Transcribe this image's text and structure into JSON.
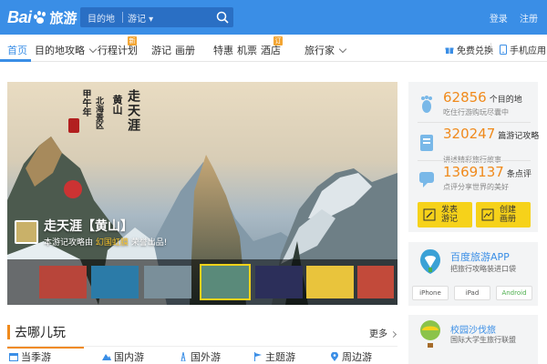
{
  "header": {
    "logo_text": "Bai",
    "logo_product": "旅游",
    "search_placeholder": "目的地",
    "search_kind": "游记",
    "top_links": [
      "登录",
      "注册"
    ]
  },
  "nav": {
    "items": [
      {
        "label": "首页",
        "active": true
      },
      {
        "label": "目的地攻略",
        "dropdown": true
      },
      {
        "label": "行程计划",
        "badge": "新"
      },
      {
        "label": "游记"
      },
      {
        "label": "画册"
      },
      {
        "label": "特惠"
      },
      {
        "label": "机票"
      },
      {
        "label": "酒店",
        "badge": "订"
      },
      {
        "label": "旅行家",
        "dropdown": true
      }
    ],
    "right": [
      {
        "label": "免费兑换",
        "icon": "gift-icon"
      },
      {
        "label": "手机应用",
        "icon": "phone-icon"
      }
    ]
  },
  "hero": {
    "calligraphy": [
      "走天涯",
      "黄山",
      "北海景区",
      "甲午年"
    ],
    "title": "走天涯【黄山】",
    "subtitle_prefix": "本游记攻略由",
    "subtitle_highlight": "幻国虹膜",
    "subtitle_suffix": "荣誉出品!",
    "thumbnails": 7,
    "active_thumbnail": 3
  },
  "stats": [
    {
      "number": "62856",
      "unit": "个目的地",
      "desc": "吃住行游购玩尽囊中",
      "icon": "footprint-icon"
    },
    {
      "number": "320247",
      "unit": "篇游记攻略",
      "desc": "讲述精彩旅行故事",
      "icon": "book-icon"
    },
    {
      "number": "1369137",
      "unit": "条点评",
      "desc": "点评分享世界的美好",
      "icon": "comment-icon"
    }
  ],
  "actions": [
    {
      "line1": "发表",
      "line2": "游记",
      "icon": "write-icon"
    },
    {
      "line1": "创建",
      "line2": "画册",
      "icon": "album-icon"
    }
  ],
  "app_promo": {
    "title": "百度旅游APP",
    "subtitle": "把旅行攻略装进口袋",
    "platforms": [
      "iPhone",
      "iPad",
      "Android"
    ],
    "icon": "app-icon"
  },
  "campus": {
    "title": "校园沙伐旅",
    "subtitle": "国际大学生旅行联盟",
    "icon": "balloon-icon"
  },
  "where": {
    "title": "去哪儿玩",
    "more": "更多",
    "tabs": [
      {
        "label": "当季游",
        "icon": "calendar-icon"
      },
      {
        "label": "国内游",
        "icon": "mountain-icon"
      },
      {
        "label": "国外游",
        "icon": "tower-icon"
      },
      {
        "label": "主题游",
        "icon": "flag-icon"
      },
      {
        "label": "周边游",
        "icon": "pin-icon"
      }
    ]
  },
  "colors": {
    "brand_blue": "#3a8ee6",
    "accent_orange": "#f08a1c",
    "button_yellow": "#f6d21a"
  }
}
